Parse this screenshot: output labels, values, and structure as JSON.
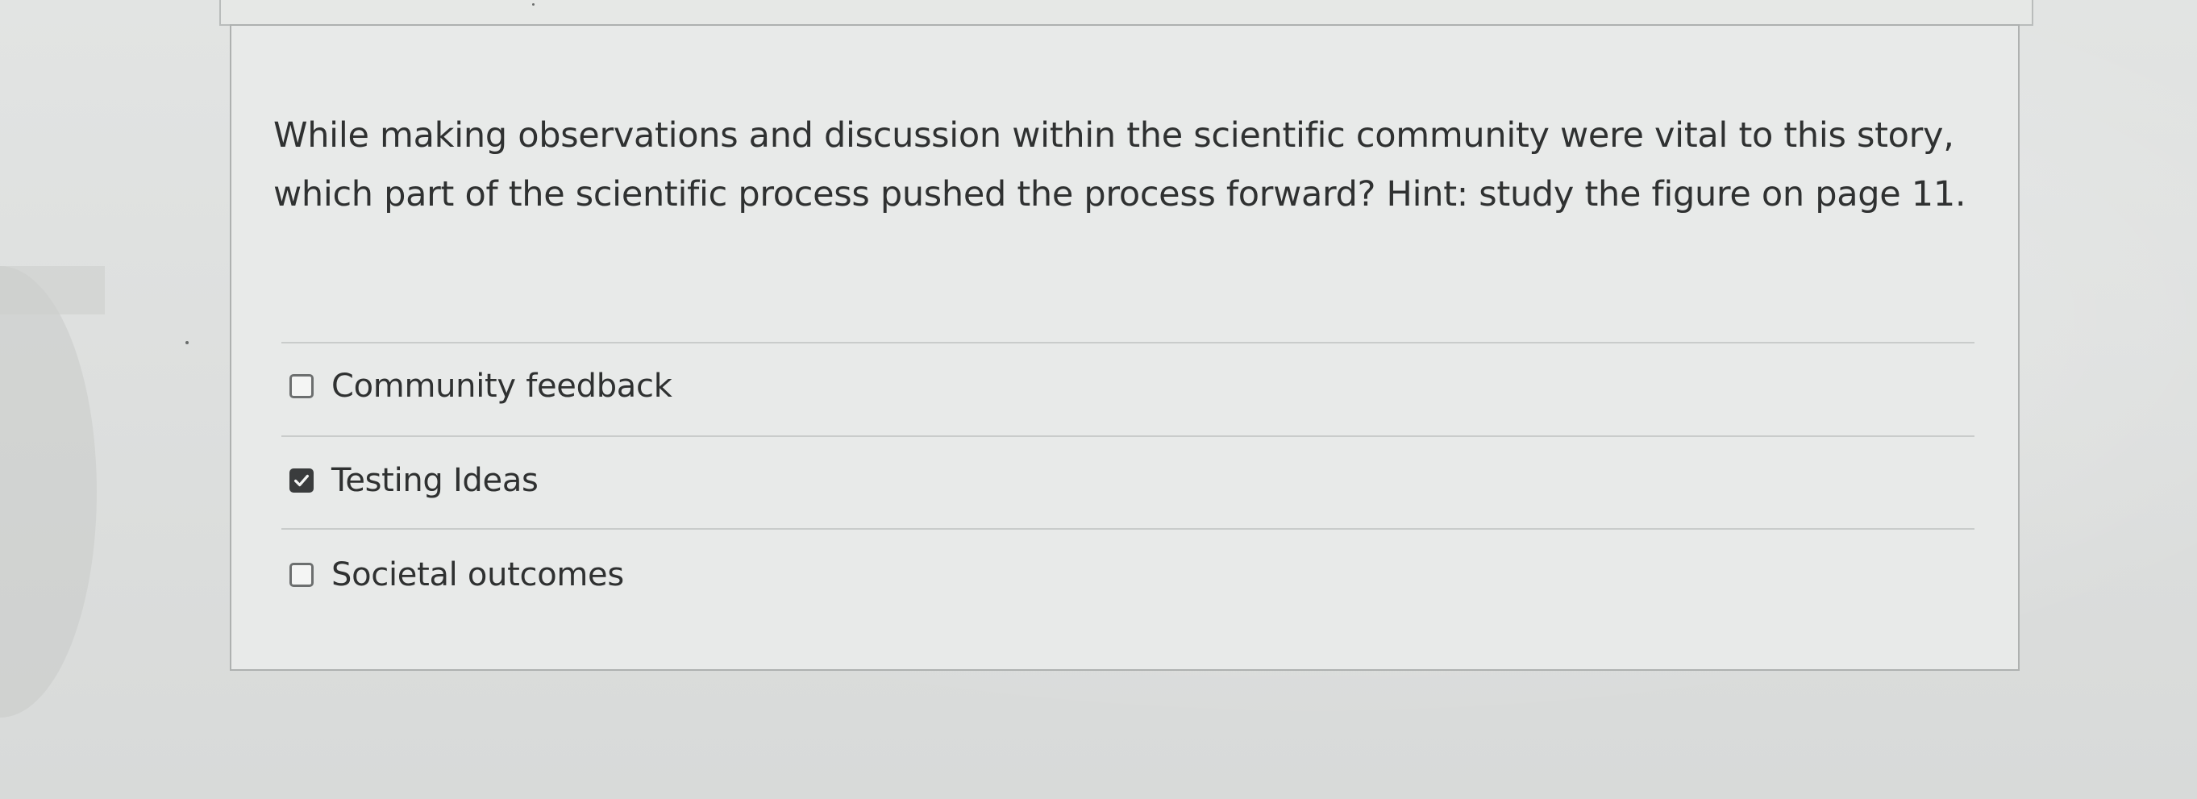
{
  "question": {
    "text": "While making observations and discussion within the scientific community were vital to this story, which part of the scientific process pushed the process forward? Hint: study the figure on page 11."
  },
  "answers": [
    {
      "label": "Community feedback",
      "checked": false
    },
    {
      "label": "Testing Ideas",
      "checked": true
    },
    {
      "label": "Societal outcomes",
      "checked": false
    }
  ],
  "colors": {
    "text": "#2f3131",
    "checkbox_checked": "#3a3c3d",
    "card_background": "#e8eae9"
  }
}
